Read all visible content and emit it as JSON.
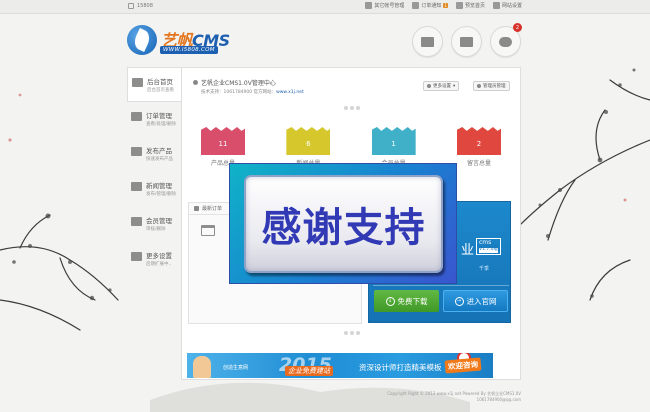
{
  "topbar": {
    "user": "15808",
    "links": [
      {
        "label": "其它帐号管理"
      },
      {
        "label": "订单通知",
        "count": "1"
      },
      {
        "label": "预览首页"
      },
      {
        "label": "网站设置"
      }
    ]
  },
  "header": {
    "logo_title_a": "艺帆",
    "logo_title_b": "CMS",
    "logo_url": "WWW.I5808.COM",
    "icons": [
      "user-icon",
      "truck-icon",
      "chat-icon"
    ],
    "chat_badge": "2"
  },
  "sidebar": {
    "items": [
      {
        "title": "后台首页",
        "sub": "后台首页查看"
      },
      {
        "title": "订单管理",
        "sub": "查看/处理/删除"
      },
      {
        "title": "发布产品",
        "sub": "快速发布产品"
      },
      {
        "title": "新闻管理",
        "sub": "发布/管理/删除"
      },
      {
        "title": "会员管理",
        "sub": "审核/删除"
      },
      {
        "title": "更多设置",
        "sub": "后期扩展中.."
      }
    ]
  },
  "welcome": {
    "line1": "艺帆企业CMS1.0V管理中心",
    "line2_prefix": "技术支持：1061784900 官方网站：",
    "line2_url": "www.x1j.net"
  },
  "buttons": {
    "more_settings": "更多设置",
    "admin_manage": "管理员管理"
  },
  "stats": [
    {
      "value": "11",
      "label": "产品总量",
      "color": "#d94e6b"
    },
    {
      "value": "6",
      "label": "新闻总量",
      "color": "#d6c72d"
    },
    {
      "value": "1",
      "label": "会员总量",
      "color": "#3fb0c7"
    },
    {
      "value": "2",
      "label": "留言总量",
      "color": "#e0473f"
    }
  ],
  "orders": {
    "header": "最新订单"
  },
  "promo": {
    "big": "业",
    "version": "cms",
    "version_tag": "V1.7.0版",
    "subtitle": "千季",
    "download": "免费下载",
    "official": "进入官网"
  },
  "banner": {
    "left_text": "创造生意网",
    "year": "2015",
    "slogan": "企业免费建站",
    "middle": "资深设计师打造精美模板",
    "right": "欢迎咨询"
  },
  "overlay": {
    "text": "感谢支持"
  },
  "footer": {
    "line1": "Copyright Right © 2013 www.x1j.net Powered By 艺帆企业CMS1.0V",
    "line2": "1061784900@qq.com"
  }
}
